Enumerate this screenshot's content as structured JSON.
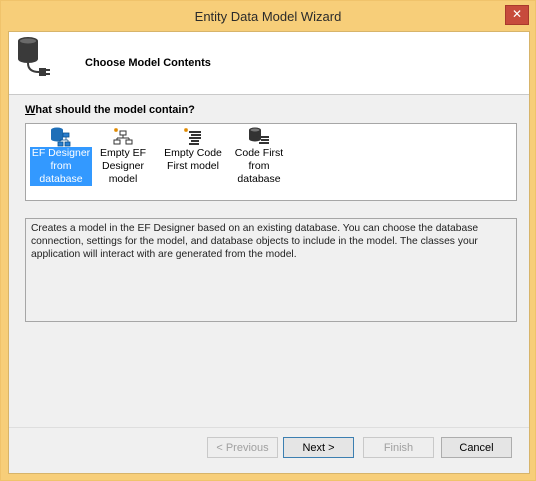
{
  "window": {
    "title": "Entity Data Model Wizard",
    "close_glyph": "✕"
  },
  "header": {
    "title": "Choose Model Contents",
    "icon": "database-plug-icon"
  },
  "question": {
    "text": "What should the model contain?",
    "mnemonic": "W"
  },
  "model_options": [
    {
      "label": "EF Designer from database",
      "lines": [
        "EF Designer",
        "from",
        "database"
      ],
      "icon": "ef-designer-database-icon",
      "selected": true
    },
    {
      "label": "Empty EF Designer model",
      "lines": [
        "Empty EF",
        "Designer",
        "model"
      ],
      "icon": "empty-designer-icon",
      "selected": false
    },
    {
      "label": "Empty Code First model",
      "lines": [
        "Empty Code",
        "First model"
      ],
      "icon": "empty-code-first-icon",
      "selected": false
    },
    {
      "label": "Code First from database",
      "lines": [
        "Code First",
        "from",
        "database"
      ],
      "icon": "code-first-database-icon",
      "selected": false
    }
  ],
  "description": "Creates a model in the EF Designer based on an existing database. You can choose the database connection, settings for the model, and database objects to include in the model. The classes your application will interact with are generated from the model.",
  "buttons": {
    "previous": "< Previous",
    "next": "Next >",
    "finish": "Finish",
    "cancel": "Cancel"
  },
  "colors": {
    "titlebar": "#f7ce79",
    "selection": "#3399ff",
    "close": "#c74b3c"
  }
}
